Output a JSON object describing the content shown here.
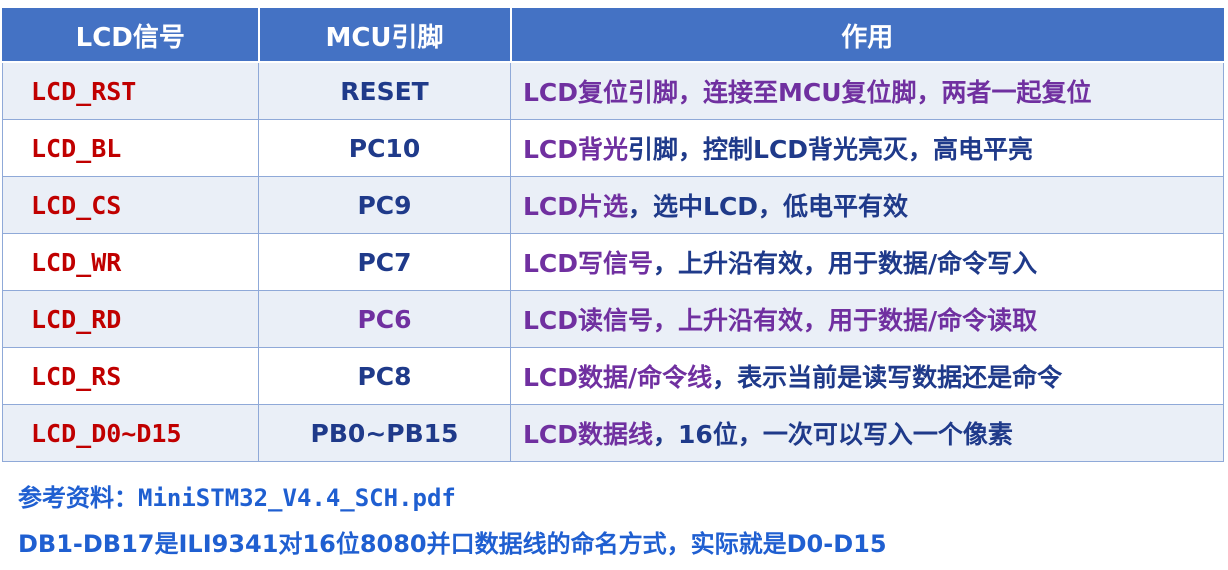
{
  "table": {
    "headers": [
      "LCD信号",
      "MCU引脚",
      "作用"
    ],
    "rows": [
      {
        "signal": "LCD_RST",
        "pin": "RESET",
        "desc_head": "LCD复位",
        "desc_tail": "引脚，连接至MCU复位脚，两者一起复位",
        "pin_color": "#1f3a8a",
        "tail_color": "#7030a0"
      },
      {
        "signal": "LCD_BL",
        "pin": "PC10",
        "desc_head": "LCD背光",
        "desc_tail": "引脚，控制LCD背光亮灭，高电平亮",
        "pin_color": "#1f3a8a",
        "tail_color": "#1f3a8a"
      },
      {
        "signal": "LCD_CS",
        "pin": "PC9",
        "desc_head": "LCD片选",
        "desc_tail": "，选中LCD，低电平有效",
        "pin_color": "#1f3a8a",
        "tail_color": "#1f3a8a"
      },
      {
        "signal": "LCD_WR",
        "pin": "PC7",
        "desc_head": "LCD写信号",
        "desc_tail": "，上升沿有效，用于数据/命令写入",
        "pin_color": "#1f3a8a",
        "tail_color": "#1f3a8a"
      },
      {
        "signal": "LCD_RD",
        "pin": "PC6",
        "desc_head": "LCD读信号",
        "desc_tail": "，上升沿有效，用于数据/命令读取",
        "pin_color": "#7030a0",
        "tail_color": "#7030a0"
      },
      {
        "signal": "LCD_RS",
        "pin": "PC8",
        "desc_head": "LCD数据/命令线",
        "desc_tail": "，表示当前是读写数据还是命令",
        "pin_color": "#1f3a8a",
        "tail_color": "#1f3a8a"
      },
      {
        "signal": "LCD_D0~D15",
        "pin": "PB0~PB15",
        "desc_head": "LCD数据线",
        "desc_tail": "，16位，一次可以写入一个像素",
        "pin_color": "#1f3a8a",
        "tail_color": "#1f3a8a"
      }
    ]
  },
  "notes": {
    "reference": "参考资料：MiniSTM32_V4.4_SCH.pdf",
    "db_note": "DB1-DB17是ILI9341对16位8080并口数据线的命名方式，实际就是D0-D15"
  },
  "colors": {
    "header_bg": "#4472c4",
    "signal_red": "#c00000",
    "text_navy": "#1f3a8a",
    "text_purple": "#7030a0",
    "note_blue": "#1f5fd1",
    "row_shade": "#eaeff7"
  }
}
